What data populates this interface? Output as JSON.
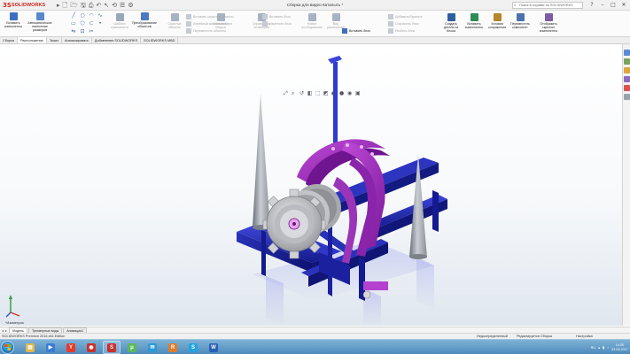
{
  "app": {
    "brand_ds": "3S",
    "brand_name": "SOLIDWORKS",
    "window_title": "Сборка для видео Каталыть *",
    "search_placeholder": "Поиск в справке по SOLIDWORKS"
  },
  "ribbon": {
    "big_buttons": [
      {
        "name": "insert-components-button",
        "label": "Вставить\nкомпоненты",
        "icon": "insert-components-icon",
        "color": "#3c6fc2",
        "enabled": true
      },
      {
        "name": "mate-button",
        "label": "Автоматическое\nнанесение размеров",
        "icon": "mate-icon",
        "color": "#5a87c9",
        "enabled": true
      },
      {
        "name": "component-pattern-button",
        "label": "Шаблон\nкомпонента",
        "icon": "pattern-icon",
        "color": "#9aa7b8",
        "enabled": false
      },
      {
        "name": "move-component-button",
        "label": "Преобразование\nобъектов",
        "icon": "move-icon",
        "color": "#4b79c4",
        "enabled": true
      },
      {
        "name": "show-hidden-button",
        "label": "Скрытые\nобъекты",
        "icon": "show-hidden-icon",
        "color": "#a7b3c2",
        "enabled": false
      },
      {
        "name": "assembly-features-button",
        "label": "Элементы\nсборки",
        "icon": "assembly-features-icon",
        "color": "#a7b3c2",
        "enabled": false
      },
      {
        "name": "reference-geometry-button",
        "label": "Справочная\nгеометрия",
        "icon": "reference-geometry-icon",
        "color": "#a7b3c2",
        "enabled": false
      },
      {
        "name": "new-motion-study-button",
        "label": "Новое\nисследование",
        "icon": "motion-study-icon",
        "color": "#a7b3c2",
        "enabled": false
      },
      {
        "name": "bill-of-materials-button",
        "label": "Вид\nразнесения",
        "icon": "explode-icon",
        "color": "#a7b3c2",
        "enabled": false
      },
      {
        "name": "create-parts-button",
        "label": "Создать\nдеталь из\nблока",
        "icon": "create-parts-icon",
        "color": "#2f5e9e",
        "enabled": true
      },
      {
        "name": "insert-components2-button",
        "label": "Вставить\nкомпоненты",
        "icon": "insert-components-icon",
        "color": "#2e8b57",
        "enabled": true
      },
      {
        "name": "conditional-mates-button",
        "label": "Условия\nсопряжения",
        "icon": "conditions-icon",
        "color": "#b5862a",
        "enabled": true
      },
      {
        "name": "rename-components-button",
        "label": "Переместить\nкомпонент",
        "icon": "rename-icon",
        "color": "#4a72b0",
        "enabled": true
      },
      {
        "name": "open-components-button",
        "label": "Отобразить\nскрытые\nкомпоненты",
        "icon": "open-components-icon",
        "color": "#7a5ca8",
        "enabled": true
      }
    ],
    "rows": [
      {
        "name": "ribbon-row-1",
        "label": "Вставить скрытые объекты",
        "enabled": false
      },
      {
        "name": "ribbon-row-2",
        "label": "Линейный массив шаблон",
        "enabled": false
      },
      {
        "name": "ribbon-row-3",
        "label": "Переместить объекты",
        "enabled": false
      },
      {
        "name": "ribbon-row-4",
        "label": "Вставить блок",
        "enabled": false
      },
      {
        "name": "ribbon-row-5",
        "label": "Изменить блок",
        "enabled": false
      },
      {
        "name": "ribbon-row-6",
        "label": "Вставить блок",
        "enabled": true
      },
      {
        "name": "ribbon-row-7",
        "label": "Добавить/Удалить",
        "enabled": false
      },
      {
        "name": "ribbon-row-8",
        "label": "Сохранить блок",
        "enabled": false
      },
      {
        "name": "ribbon-row-9",
        "label": "Разбить блок",
        "enabled": false
      }
    ]
  },
  "tabs": [
    {
      "name": "tab-assembly",
      "label": "Сборка",
      "active": false
    },
    {
      "name": "tab-layout",
      "label": "Расположение",
      "active": true
    },
    {
      "name": "tab-sketch",
      "label": "Эскиз",
      "active": false
    },
    {
      "name": "tab-evaluate",
      "label": "Анализировать",
      "active": false
    },
    {
      "name": "tab-addins",
      "label": "Добавления SOLIDWORKS",
      "active": false
    },
    {
      "name": "tab-mbd",
      "label": "SOLIDWORKS MBD",
      "active": false
    }
  ],
  "viewport": {
    "view_label": "*Изометрия"
  },
  "bottom_tabs": [
    {
      "name": "bottom-tab-model",
      "label": "Модель",
      "active": true
    },
    {
      "name": "bottom-tab-3d-views",
      "label": "Трехмерные виды",
      "active": false
    },
    {
      "name": "bottom-tab-animation",
      "label": "Анимация1",
      "active": false
    }
  ],
  "status": {
    "product": "SOLIDWORKS Premium 2016 x64 Edition",
    "state_1": "Недоопределенный",
    "state_2": "Редактируется Сборка",
    "config": "Настройка"
  },
  "taskbar": {
    "lang": "RU",
    "time": "14:20",
    "date": "23.03.2017",
    "apps": [
      {
        "name": "taskbar-explorer",
        "glyph": "▤",
        "color": "#e0b850",
        "open": false
      },
      {
        "name": "taskbar-media",
        "glyph": "▶",
        "color": "#3a7bd5",
        "open": false
      },
      {
        "name": "taskbar-yandex",
        "glyph": "Y",
        "color": "#e83a2a",
        "open": false
      },
      {
        "name": "taskbar-app-red",
        "glyph": "◉",
        "color": "#c9302c",
        "open": false
      },
      {
        "name": "taskbar-solidworks",
        "glyph": "S",
        "color": "#c9302c",
        "open": true
      },
      {
        "name": "taskbar-utorrent",
        "glyph": "μ",
        "color": "#5cb85c",
        "open": false
      },
      {
        "name": "taskbar-chat",
        "glyph": "✉",
        "color": "#2b9ad6",
        "open": false
      },
      {
        "name": "taskbar-r-app",
        "glyph": "R",
        "color": "#e07b2a",
        "open": false
      },
      {
        "name": "taskbar-skype",
        "glyph": "S",
        "color": "#22a3e0",
        "open": false
      },
      {
        "name": "taskbar-word",
        "glyph": "W",
        "color": "#2b5fb3",
        "open": false
      }
    ]
  }
}
